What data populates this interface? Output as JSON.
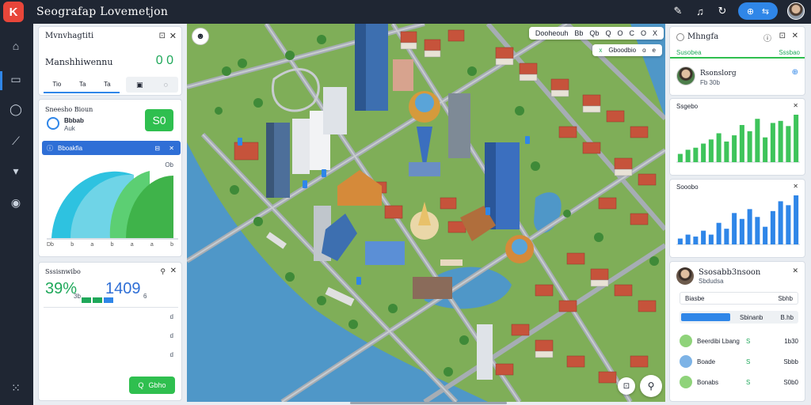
{
  "app": {
    "title": "Seografap Lovemetjon"
  },
  "topbar": {
    "pill_icons": [
      "globe-icon",
      "share-icon"
    ]
  },
  "rail": {
    "items": [
      "home-icon",
      "panel-icon",
      "chat-icon",
      "chart-icon",
      "download-icon",
      "camera-icon",
      "grid-icon"
    ]
  },
  "left": {
    "card1": {
      "title": "Mvnvhagtiti",
      "subtitle": "Manshhiwennu",
      "value": "0 0",
      "tabs": [
        "Tio",
        "Ta",
        "Ta"
      ]
    },
    "card2": {
      "title": "Sneesho Bioun",
      "subtitle": "Bbbab",
      "sub2": "Auk",
      "badge": "S0",
      "bar_label": "Bboakfia",
      "chart_label_top": "Ob",
      "axis_labels": [
        "Db",
        "b",
        "a",
        "b",
        "a",
        "a",
        "b"
      ]
    },
    "card3": {
      "title": "Sssisnwibo",
      "value1": "39%",
      "value1_sub": "3b",
      "value2": "1409",
      "value2_sub": "6",
      "row_markers": [
        "d",
        "d",
        "d"
      ],
      "button": "Gbho",
      "button_icon": "Q"
    }
  },
  "map": {
    "toolbar": {
      "label": "Dooheouh",
      "icons": [
        "Bb",
        "Qb",
        "Q",
        "O",
        "C",
        "O",
        "X"
      ]
    },
    "subbar": {
      "label": "Gboodbio",
      "icons": [
        "x",
        "o",
        "e"
      ]
    },
    "colors": {
      "water": "#4f97c8",
      "grass": "#7fae58",
      "road": "#9aa0a6",
      "roof": "#c6533b"
    }
  },
  "right": {
    "header": {
      "title": "Mhngfa",
      "tab_left": "Susobea",
      "tab_right": "Sssbao"
    },
    "profile": {
      "name": "Rsonslorg",
      "sub": "Fb 30b"
    },
    "chart1": {
      "title": "Ssgebo",
      "color": "#3ec45b",
      "values": [
        8,
        12,
        14,
        18,
        22,
        28,
        20,
        26,
        36,
        30,
        42,
        24,
        38,
        40,
        35,
        46
      ]
    },
    "chart2": {
      "title": "Sooobo",
      "color": "#2f86e8",
      "values": [
        6,
        10,
        8,
        14,
        10,
        22,
        16,
        32,
        26,
        36,
        28,
        18,
        34,
        44,
        40,
        50
      ]
    },
    "list": {
      "title": "Ssosabb3nsoon",
      "subtitle": "Sbdudsa",
      "row1_label": "Biasbe",
      "row1_value": "Sbhb",
      "row2_label": "Sbinanb",
      "row2_value": "B.hb",
      "items": [
        {
          "name": "Beerdibi Lbang",
          "mark": "S",
          "value": "1b30"
        },
        {
          "name": "Boade",
          "mark": "S",
          "value": "Sbbb"
        },
        {
          "name": "Bonabs",
          "mark": "S",
          "value": "S0b0"
        }
      ]
    }
  }
}
